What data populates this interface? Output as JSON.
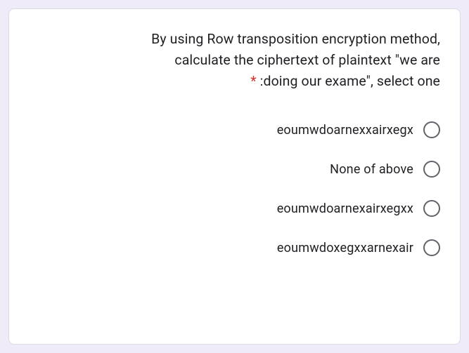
{
  "question": {
    "line1": "By using Row transposition encryption method,",
    "line2": "calculate the ciphertext of plaintext \"we are",
    "line3_pre": ":doing our exame\", select one",
    "asterisk": "*"
  },
  "options": [
    {
      "label": "eoumwdoarnexxairxegx"
    },
    {
      "label": "None of above"
    },
    {
      "label": "eoumwdoarnexairxegxx"
    },
    {
      "label": "eoumwdoxegxxarnexair"
    }
  ]
}
